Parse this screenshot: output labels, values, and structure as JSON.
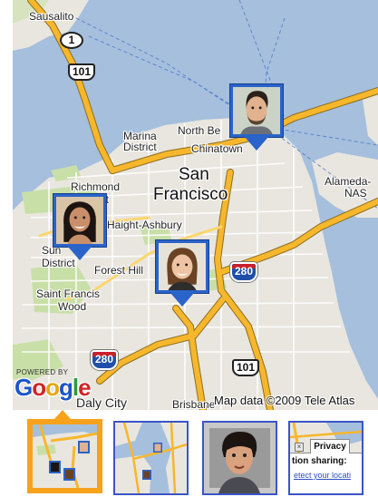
{
  "map": {
    "place_labels": {
      "sausalito": "Sausalito",
      "marina": "Marina\nDistrict",
      "north_beach": "North Be",
      "chinatown": "Chinatown",
      "san_francisco_line1": "San",
      "san_francisco_line2": "Francisco",
      "richmond": "Richmond",
      "richmond_district": "rict",
      "alameda": "Alameda-",
      "nas": "NAS",
      "haight": "Haight-Ashbury",
      "sunset": "Sun",
      "sunset_district": "District",
      "forest_hill": "Forest Hill",
      "saint_francis": "Saint Francis",
      "wood": "Wood",
      "daly_city": "Daly City",
      "brisbane": "Brisbane"
    },
    "shields": {
      "route1": "1",
      "us101_north": "101",
      "i280_east": "280",
      "i280_south": "280",
      "us101_south": "101"
    },
    "markers": [
      {
        "name": "profile-marker-man",
        "photo": "man-face"
      },
      {
        "name": "profile-marker-woman-dark-hair",
        "photo": "woman-dark-hair-face"
      },
      {
        "name": "profile-marker-woman-brown-hair",
        "photo": "woman-brown-hair-face"
      }
    ],
    "powered_by": "POWERED BY",
    "logo_text": [
      "G",
      "o",
      "o",
      "g",
      "l",
      "e"
    ],
    "attribution": "Map data ©2009 Tele Atlas"
  },
  "thumbnails": {
    "selected_index": 0,
    "items": [
      {
        "name": "thumb-map-view",
        "kind": "map"
      },
      {
        "name": "thumb-bay-map",
        "kind": "map"
      },
      {
        "name": "thumb-person-photo",
        "kind": "photo"
      },
      {
        "name": "thumb-privacy-settings",
        "kind": "screen"
      }
    ],
    "privacy": {
      "tab_label": "Privacy",
      "heading": "tion sharing:",
      "link": "etect your locati"
    }
  },
  "colors": {
    "water": "#a5bfdd",
    "land": "#e9e6df",
    "park": "#c9dfa8",
    "highway": "#f7b72c",
    "marker_blue": "#2a63c9",
    "selection_orange": "#f7a21d",
    "thumb_border": "#3b55c7"
  }
}
